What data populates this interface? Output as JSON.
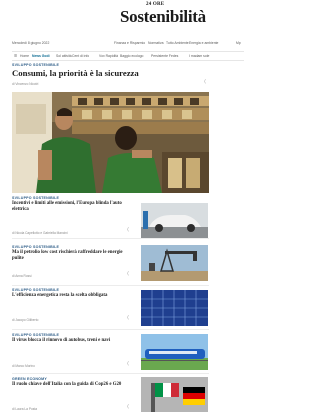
{
  "masthead": {
    "kicker": "24 ORE",
    "title": "Sostenibilità"
  },
  "date_bar": {
    "date": "Mercoledì 8 giugno 2022",
    "links": [
      "Finanza e Risparmio",
      "Normativa",
      "Tutto Ambiente",
      "Energia e ambiente"
    ],
    "more": "Mp"
  },
  "nav": {
    "home_label": "Home",
    "active_label": "News Godi",
    "items": [
      "Sol attività",
      "Cent di info",
      "Vox Rapidità",
      "Baggio ecologo",
      "Persistente Fedes",
      "I madam sole"
    ]
  },
  "lead": {
    "kicker": "SVILUPPO SOSTENIBILE",
    "title": "Consumi, la priorità è la sicurezza",
    "meta": "di Vincenzo Nicotri"
  },
  "stories": [
    {
      "kicker": "SVILUPPO SOSTENIBILE",
      "title": "Incentivi e limiti alle emissioni, l'Europa blinda l'auto elettrica",
      "meta": "di Nicola Capellotto e Gabriella Mancini",
      "thumb": "electric-car"
    },
    {
      "kicker": "SVILUPPO SOSTENIBILE",
      "title": "Ma il petrolio low cost rischierà raffreddare le energie pulite",
      "meta": "di Anna Rossi",
      "thumb": "oil-pump"
    },
    {
      "kicker": "SVILUPPO SOSTENIBILE",
      "title": "L'efficienza energetica resta la scelta obbligata",
      "meta": "di Jacopo Giliberto",
      "thumb": "solar-panel"
    },
    {
      "kicker": "SVILUPPO SOSTENIBILE",
      "title": "Il virus blocca il rinnovo di autobus, treni e navi",
      "meta": "di Marco Morino",
      "thumb": "train"
    },
    {
      "kicker": "GREEN ECONOMY",
      "title": "Il ruolo chiave dell'Italia con la guida di Cop26 e G20",
      "meta": "di Laura La Posta",
      "thumb": "flags"
    }
  ],
  "icons": {
    "share": "share-icon"
  },
  "colors": {
    "kicker": "#2b5b86",
    "active_nav": "#0a6a91"
  }
}
